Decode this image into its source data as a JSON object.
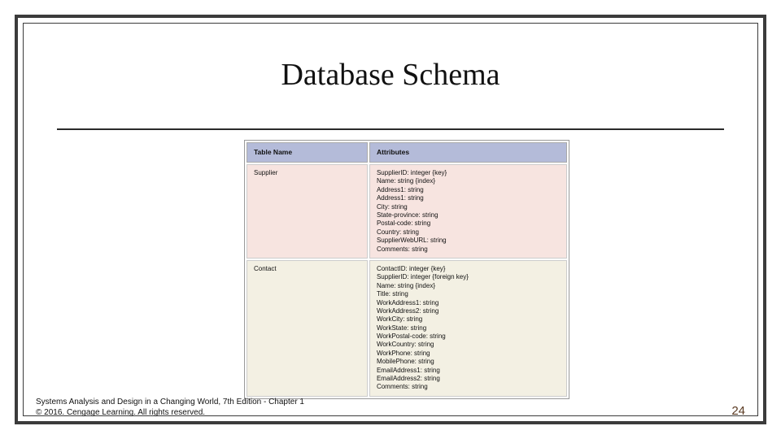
{
  "title": "Database Schema",
  "table": {
    "headers": {
      "name": "Table Name",
      "attrs": "Attributes"
    },
    "rows": [
      {
        "name": "Supplier",
        "attrs": "SupplierID: integer {key}\nName: string {index}\nAddress1: string\nAddress1: string\nCity: string\nState-province: string\nPostal-code: string\nCountry: string\nSupplierWebURL: string\nComments: string"
      },
      {
        "name": "Contact",
        "attrs": "ContactID: integer {key}\nSupplierID: integer {foreign key}\nName: string {index}\nTitle: string\nWorkAddress1: string\nWorkAddress2: string\nWorkCity: string\nWorkState: string\nWorkPostal-code: string\nWorkCountry: string\nWorkPhone: string\nMobilePhone: string\nEmailAddress1: string\nEmailAddress2: string\nComments: string"
      }
    ]
  },
  "footer": {
    "line1": "Systems Analysis and Design in a Changing World, 7th Edition - Chapter 1",
    "line2": "© 2016. Cengage Learning. All rights reserved."
  },
  "page_number": "24"
}
